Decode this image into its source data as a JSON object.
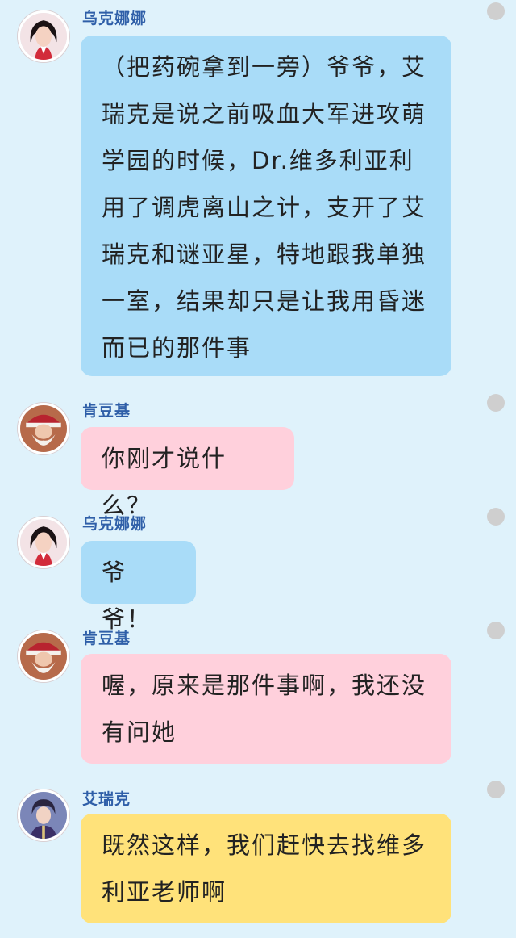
{
  "messages": [
    {
      "sender": "乌克娜娜",
      "avatar": "female-host-avatar",
      "color": "#a9dcf8",
      "text": "（把药碗拿到一旁）爷爷，艾瑞克是说之前吸血大军进攻萌学园的时候，Dr.维多利亚利用了调虎离山之计，支开了艾瑞克和谜亚星，特地跟我单独一室，结果却只是让我用昏迷而已的那件事"
    },
    {
      "sender": "肯豆基",
      "avatar": "santa-elder-avatar",
      "color": "#ffd0dc",
      "text": "你刚才说什么？"
    },
    {
      "sender": "乌克娜娜",
      "avatar": "female-host-avatar",
      "color": "#a9dcf8",
      "text": "爷爷！"
    },
    {
      "sender": "肯豆基",
      "avatar": "santa-elder-avatar",
      "color": "#ffd0dc",
      "text": "喔，原来是那件事啊，我还没有问她"
    },
    {
      "sender": "艾瑞克",
      "avatar": "young-man-avatar",
      "color": "#ffe27a",
      "text": "既然这样，我们赶快去找维多利亚老师啊"
    }
  ]
}
